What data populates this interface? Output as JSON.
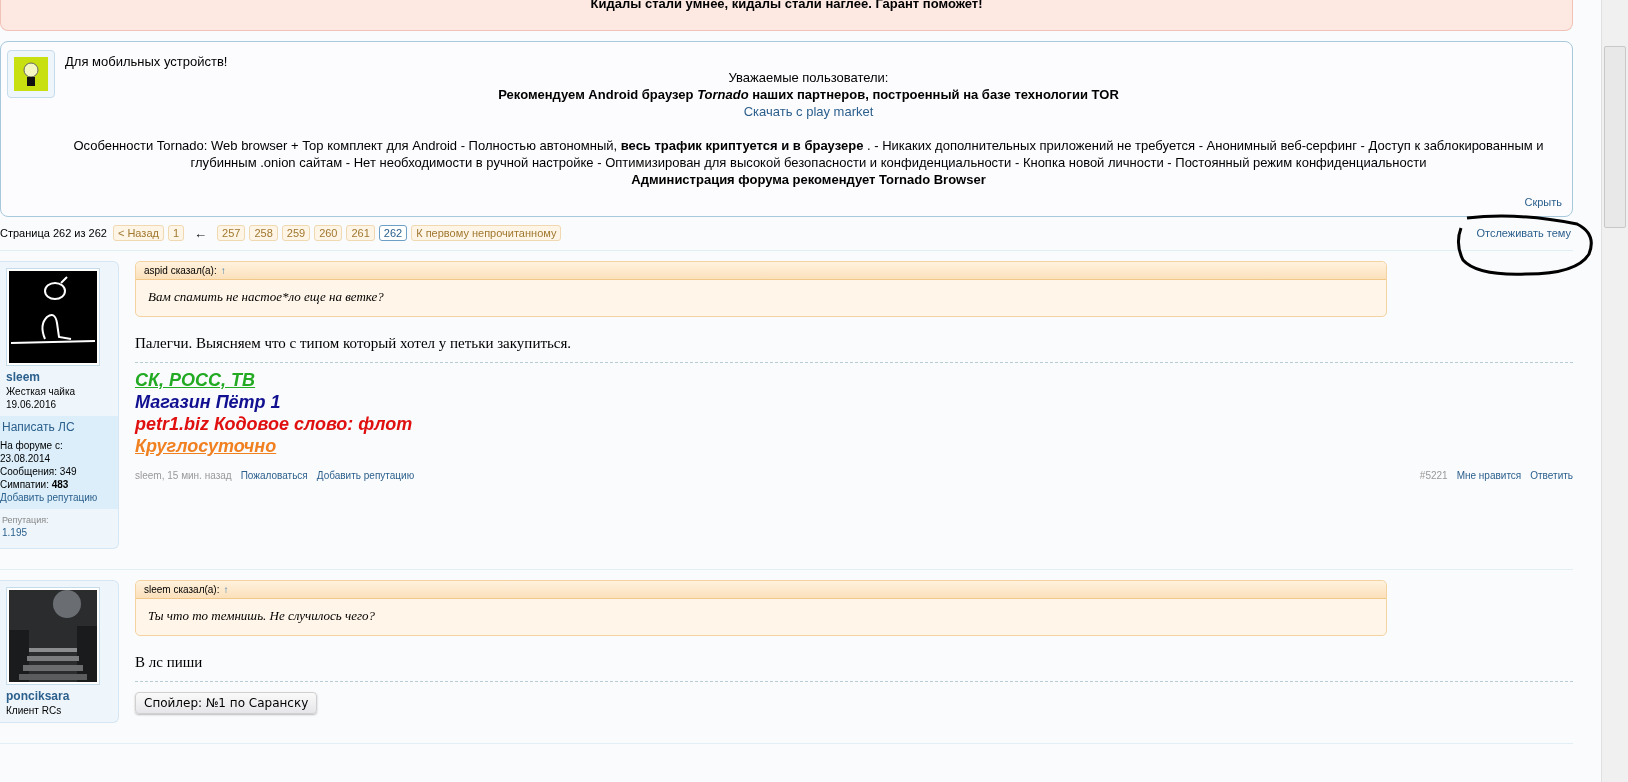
{
  "alert_banner": {
    "text": "Кидалы стали умнее, кидалы стали наглее. Гарант поможет!"
  },
  "notice": {
    "title": "Для мобильных устройств!",
    "greeting": "Уважаемые пользователи:",
    "headline": "Рекомендуем Android браузер *Tornado* наших партнеров, построенный на базе технологии TOR",
    "download_link": "Скачать с play market",
    "features": "Особенности Tornado: Web browser + Тор комплект для Android - Полностью автономный, **весь трафик криптуется и в браузере** . - Никаких дополнительных приложений не требуется - Анонимный веб-серфинг - Доступ к заблокированным и глубинным .onion сайтам - Нет необходимости в ручной настройке - Оптимизирован для высокой безопасности и конфиденциальности - Кнопка новой личности - Постоянный режим конфиденциальности",
    "closing": "Администрация форума рекомендует Tornado Browser",
    "hide_link": "Скрыть"
  },
  "pagination": {
    "label": "Страница 262 из 262",
    "prev": "< Назад",
    "first_pages": [
      {
        "label": "1",
        "selected": false
      }
    ],
    "gap_arrow": "←",
    "pages": [
      {
        "label": "257",
        "selected": false
      },
      {
        "label": "258",
        "selected": false
      },
      {
        "label": "259",
        "selected": false
      },
      {
        "label": "260",
        "selected": false
      },
      {
        "label": "261",
        "selected": false
      },
      {
        "label": "262",
        "selected": true
      }
    ],
    "unread": "К первому непрочитанному",
    "watch_link": "Отслеживать тему"
  },
  "posts": [
    {
      "user": {
        "name": "sleem",
        "title": "Жесткая чайка",
        "date": "19.06.2016",
        "extra": {
          "pm_link": "Написать ЛС",
          "since_label": "На форуме с:",
          "since": "23.08.2014",
          "messages": "Сообщения: 349",
          "likes": "Симпатии: **483**",
          "rep_link": "Добавить репутацию",
          "rep_label": "Репутация:",
          "rep_value": "1.195"
        }
      },
      "quote": {
        "author": "aspid сказал(а):",
        "jump": "↑",
        "text": "Вам спамить не настое*ло еще на ветке?"
      },
      "message": "Палегчи. Выясняем что с типом который хотел у петьки закупиться.",
      "signature": [
        {
          "text": "СК, РОСС, ТВ",
          "color": "#22aa22",
          "underlined": true
        },
        {
          "text": "Магазин Пётр 1",
          "color": "#101090",
          "underlined": false
        },
        {
          "text": "petr1.biz Кодовое слово: флот",
          "color": "#e01010",
          "underlined": false
        },
        {
          "text": "Круглосуточно",
          "color": "#f08020",
          "underlined": true
        }
      ],
      "footer": {
        "meta": "sleem, 15 мин. назад",
        "links": [
          "Пожаловаться",
          "Добавить репутацию"
        ],
        "number": "#5221",
        "actions": [
          "Мне нравится",
          "Ответить"
        ]
      }
    },
    {
      "user": {
        "name": "ponciksara",
        "title": "Клиент RCs"
      },
      "quote": {
        "author": "sleem сказал(а):",
        "jump": "↑",
        "text": "Ты что то темнишь. Не случилось чего?"
      },
      "message": "В лс пиши",
      "spoiler": "Спойлер: №1 по Саранску"
    }
  ]
}
